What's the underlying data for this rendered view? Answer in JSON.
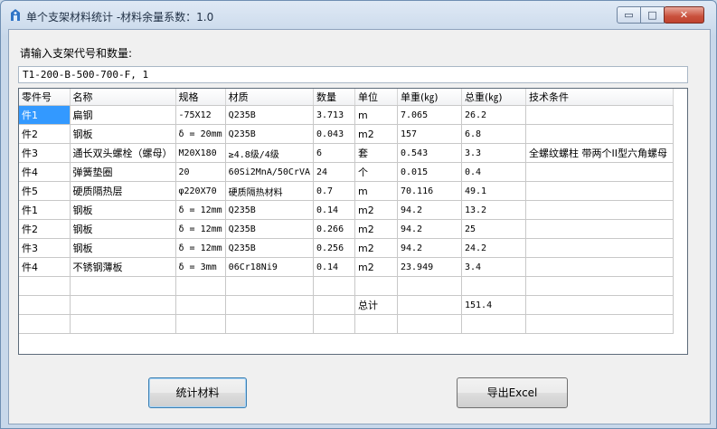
{
  "window": {
    "title": "单个支架材料统计 -材料余量系数：1.0",
    "minimize_glyph": "▭",
    "maximize_glyph": "□",
    "close_glyph": "✕"
  },
  "prompt_label": "请输入支架代号和数量:",
  "input_value": "T1-200-B-500-700-F, 1",
  "table": {
    "columns": [
      "零件号",
      "名称",
      "规格",
      "材质",
      "数量",
      "单位",
      "单重(㎏)",
      "总重(㎏)",
      "技术条件"
    ],
    "rows": [
      [
        "件1",
        "扁钢",
        "-75X12",
        "Q235B",
        "3.713",
        "m",
        "7.065",
        "26.2",
        ""
      ],
      [
        "件2",
        "钢板",
        "δ = 20mm",
        "Q235B",
        "0.043",
        "m2",
        "157",
        "6.8",
        ""
      ],
      [
        "件3",
        "通长双头螺栓（螺母）",
        "M20X180",
        "≥4.8级/4级",
        "6",
        "套",
        "0.543",
        "3.3",
        "全螺纹螺柱 带两个II型六角螺母"
      ],
      [
        "件4",
        "弹簧垫圈",
        "20",
        "60Si2MnA/50CrVA",
        "24",
        "个",
        "0.015",
        "0.4",
        ""
      ],
      [
        "件5",
        "硬质隔热层",
        "φ220X70",
        "硬质隔热材料",
        "0.7",
        "m",
        "70.116",
        "49.1",
        ""
      ],
      [
        "件1",
        "钢板",
        "δ = 12mm",
        "Q235B",
        "0.14",
        "m2",
        "94.2",
        "13.2",
        ""
      ],
      [
        "件2",
        "钢板",
        "δ = 12mm",
        "Q235B",
        "0.266",
        "m2",
        "94.2",
        "25",
        ""
      ],
      [
        "件3",
        "钢板",
        "δ = 12mm",
        "Q235B",
        "0.256",
        "m2",
        "94.2",
        "24.2",
        ""
      ],
      [
        "件4",
        "不锈钢薄板",
        "δ = 3mm",
        "06Cr18Ni9",
        "0.14",
        "m2",
        "23.949",
        "3.4",
        ""
      ],
      [
        "",
        "",
        "",
        "",
        "",
        "",
        "",
        "",
        ""
      ],
      [
        "",
        "",
        "",
        "",
        "",
        "总计",
        "",
        "151.4",
        ""
      ],
      [
        "",
        "",
        "",
        "",
        "",
        "",
        "",
        "",
        ""
      ]
    ],
    "selected_cell": "件1"
  },
  "buttons": {
    "stats_label": "统计材料",
    "export_label": "导出Excel"
  },
  "colors": {
    "selection": "#3399ff",
    "close_button": "#c9503c"
  }
}
